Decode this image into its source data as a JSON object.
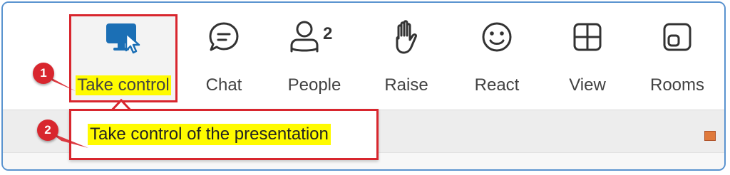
{
  "toolbar": {
    "items": [
      {
        "label": "Take control",
        "icon": "take-control-icon"
      },
      {
        "label": "Chat",
        "icon": "chat-icon"
      },
      {
        "label": "People",
        "icon": "people-icon",
        "count": "2"
      },
      {
        "label": "Raise",
        "icon": "raise-hand-icon"
      },
      {
        "label": "React",
        "icon": "react-smiley-icon"
      },
      {
        "label": "View",
        "icon": "view-grid-icon"
      },
      {
        "label": "Rooms",
        "icon": "rooms-icon"
      }
    ]
  },
  "tooltip": {
    "text": "Take control of the presentation"
  },
  "annotations": {
    "step1": "1",
    "step2": "2"
  },
  "colors": {
    "accent": "#1b6fb5",
    "highlight": "#fffb00",
    "callout": "#d8262e",
    "frame": "#5a93cf"
  }
}
